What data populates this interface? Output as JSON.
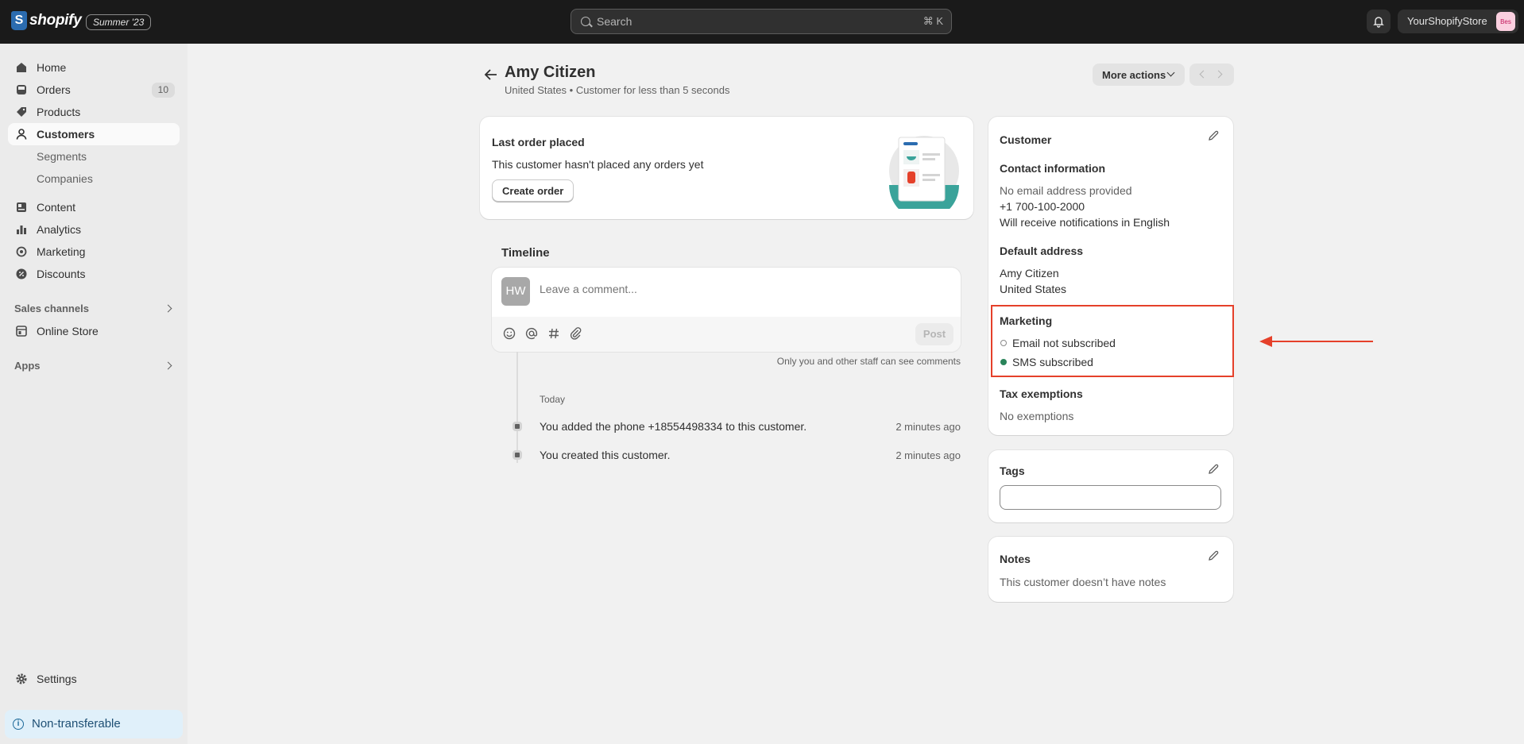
{
  "topbar": {
    "brand": "shopify",
    "edition": "Summer '23",
    "search_placeholder": "Search",
    "search_shortcut": "⌘ K",
    "store_name": "YourShopifyStore",
    "store_avatar": "Bes"
  },
  "sidebar": {
    "items": [
      {
        "label": "Home",
        "icon": "home-icon"
      },
      {
        "label": "Orders",
        "icon": "inbox-icon",
        "badge": "10"
      },
      {
        "label": "Products",
        "icon": "tag-icon"
      },
      {
        "label": "Customers",
        "icon": "person-icon",
        "active": true
      },
      {
        "label": "Segments",
        "sub": true
      },
      {
        "label": "Companies",
        "sub": true
      },
      {
        "label": "Content",
        "icon": "content-icon"
      },
      {
        "label": "Analytics",
        "icon": "bar-chart-icon"
      },
      {
        "label": "Marketing",
        "icon": "target-icon"
      },
      {
        "label": "Discounts",
        "icon": "discount-icon"
      }
    ],
    "sales_channels_label": "Sales channels",
    "online_store_label": "Online Store",
    "apps_label": "Apps",
    "settings_label": "Settings",
    "non_transferable_label": "Non-transferable"
  },
  "page": {
    "title": "Amy Citizen",
    "subtitle": "United States • Customer for less than 5 seconds",
    "more_actions_label": "More actions"
  },
  "last_order": {
    "title": "Last order placed",
    "text": "This customer hasn't placed any orders yet",
    "button": "Create order"
  },
  "timeline": {
    "title": "Timeline",
    "avatar": "HW",
    "comment_placeholder": "Leave a comment...",
    "post_label": "Post",
    "staff_note": "Only you and other staff can see comments",
    "day_label": "Today",
    "events": [
      {
        "text": "You added the phone +18554498334 to this customer.",
        "time": "2 minutes ago"
      },
      {
        "text": "You created this customer.",
        "time": "2 minutes ago"
      }
    ]
  },
  "customer": {
    "title": "Customer",
    "contact_title": "Contact information",
    "email": "No email address provided",
    "phone": "+1 700-100-2000",
    "notifications": "Will receive notifications in English",
    "address_title": "Default address",
    "address_name": "Amy Citizen",
    "address_country": "United States",
    "marketing_title": "Marketing",
    "email_marketing": "Email not subscribed",
    "sms_marketing": "SMS subscribed",
    "tax_title": "Tax exemptions",
    "tax_value": "No exemptions"
  },
  "tags": {
    "title": "Tags",
    "value": ""
  },
  "notes": {
    "title": "Notes",
    "text": "This customer doesn’t have notes"
  },
  "colors": {
    "accent_green": "#29845a",
    "annotation_red": "#e5402a"
  }
}
